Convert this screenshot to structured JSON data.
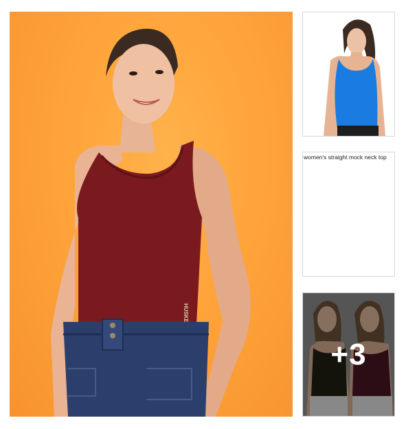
{
  "gallery": {
    "main_image": {
      "alt": "woman in maroon tank top",
      "brand_print": "HUSKERS",
      "background_color": "#ffa33a",
      "garment_color": "#7a1a1e"
    },
    "thumbnails": [
      {
        "type": "image",
        "alt": "woman in blue racerback tank",
        "garment_color": "#1a7be0"
      },
      {
        "type": "text",
        "caption": "women's straight mock neck top"
      },
      {
        "type": "image",
        "alt": "two women in black and maroon tanks",
        "more_count": "+3"
      }
    ]
  }
}
